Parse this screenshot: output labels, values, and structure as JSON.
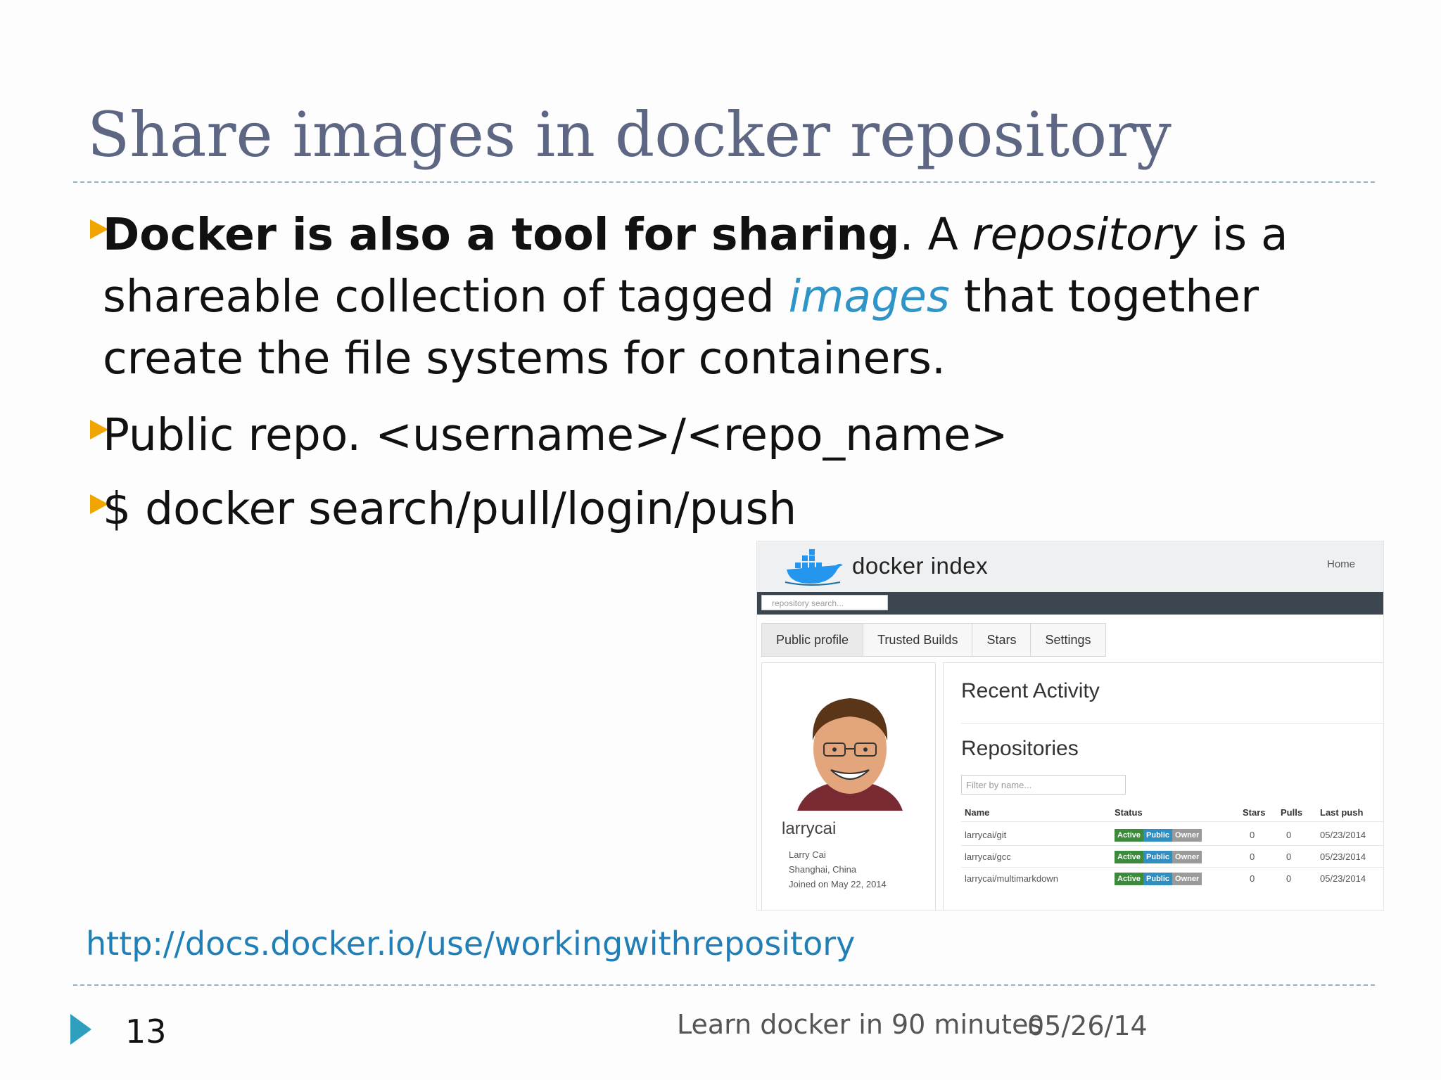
{
  "title": "Share images in docker repository",
  "bullets": {
    "b1_bold": "Docker is also a tool for sharing",
    "b1_a": ". A ",
    "b1_repository": "repository",
    "b1_b": " is a shareable collection of tagged ",
    "b1_images": "images",
    "b1_c": " that together create the file systems for containers.",
    "b2": "Public repo. <username>/<repo_name>",
    "b3": "$ docker search/pull/login/push"
  },
  "link": "http://docs.docker.io/use/workingwithrepository",
  "footer": {
    "page": "13",
    "title": "Learn docker in 90 minutes",
    "date": "05/26/14"
  },
  "screenshot": {
    "brand": "docker index",
    "home": "Home",
    "search_placeholder": "repository search...",
    "tabs": [
      "Public profile",
      "Trusted Builds",
      "Stars",
      "Settings"
    ],
    "username": "larrycai",
    "full_name": "Larry Cai",
    "location": "Shanghai, China",
    "joined": "Joined on May 22, 2014",
    "recent_activity": "Recent Activity",
    "repositories": "Repositories",
    "filter_placeholder": "Filter by name...",
    "table_headers": [
      "Name",
      "Status",
      "Stars",
      "Pulls",
      "Last push"
    ],
    "badges": [
      "Active",
      "Public",
      "Owner"
    ],
    "badge_colors": {
      "active": "#3c8a3c",
      "public": "#2f8fc3",
      "owner": "#9a9a9a"
    },
    "rows": [
      {
        "name": "larrycai/git",
        "stars": "0",
        "pulls": "0",
        "last_push": "05/23/2014"
      },
      {
        "name": "larrycai/gcc",
        "stars": "0",
        "pulls": "0",
        "last_push": "05/23/2014"
      },
      {
        "name": "larrycai/multimarkdown",
        "stars": "0",
        "pulls": "0",
        "last_push": "05/23/2014"
      }
    ]
  }
}
